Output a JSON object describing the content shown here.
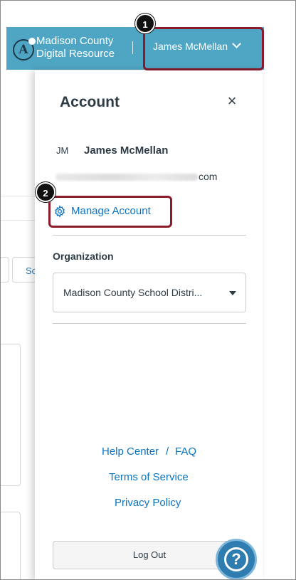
{
  "header": {
    "logo_letter": "A",
    "brand_line1": "Madison County",
    "brand_line2": "Digital Resource",
    "user_button_label": "James McMellan",
    "brand_color": "#4fa6c4",
    "highlight_color": "#8b1a2a"
  },
  "steps": [
    "1",
    "2"
  ],
  "background_page": {
    "partial_button_text": "Sc"
  },
  "account_panel": {
    "title": "Account",
    "close_icon": "close-icon",
    "avatar_initials": "JM",
    "user_name": "James McMellan",
    "email_visible_suffix": "com",
    "manage_account_label": "Manage Account",
    "manage_account_icon": "gear-icon",
    "organization_label": "Organization",
    "organization_selected": "Madison County School Distri...",
    "links": {
      "help_center": "Help Center",
      "separator": "/",
      "faq": "FAQ",
      "terms": "Terms of Service",
      "privacy": "Privacy Policy"
    },
    "logout_label": "Log Out"
  },
  "help_button": {
    "icon": "question-mark-icon",
    "glyph": "?"
  },
  "link_color": "#0b74c2"
}
